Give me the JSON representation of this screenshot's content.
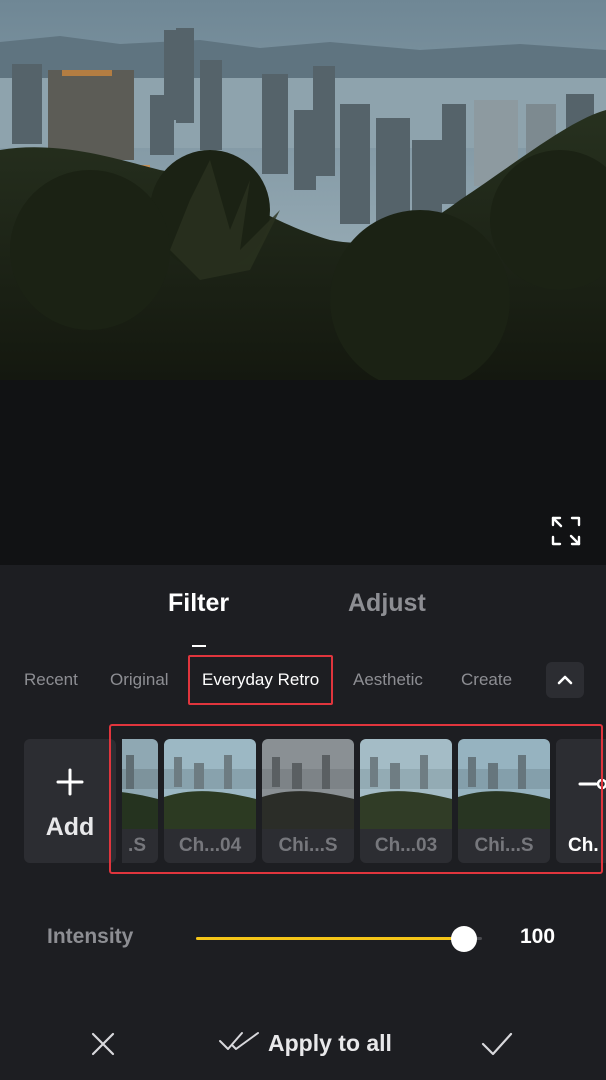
{
  "preview": {
    "expand_icon": "fullscreen-expand-icon"
  },
  "tabs": {
    "filter_label": "Filter",
    "adjust_label": "Adjust",
    "active": "Filter"
  },
  "categories": {
    "items": [
      "Recent",
      "Original",
      "Everyday Retro",
      "Aesthetic",
      "Create"
    ],
    "active": "Everyday Retro",
    "collapse_icon": "chevron-up-icon"
  },
  "filters": {
    "add_label": "Add",
    "add_icon": "plus-icon",
    "tiles": [
      ".S",
      "Ch...04",
      "Chi...S",
      "Ch...03",
      "Chi...S",
      "Ch."
    ]
  },
  "intensity": {
    "label": "Intensity",
    "value": 100,
    "value_text": "100",
    "max": 100
  },
  "actions": {
    "cancel_icon": "close-icon",
    "apply_all_label": "Apply to all",
    "apply_all_icon": "double-check-icon",
    "confirm_icon": "check-icon"
  },
  "colors": {
    "accent": "#f5c518",
    "highlight": "#e0353d",
    "panel": "#1d1e22"
  }
}
